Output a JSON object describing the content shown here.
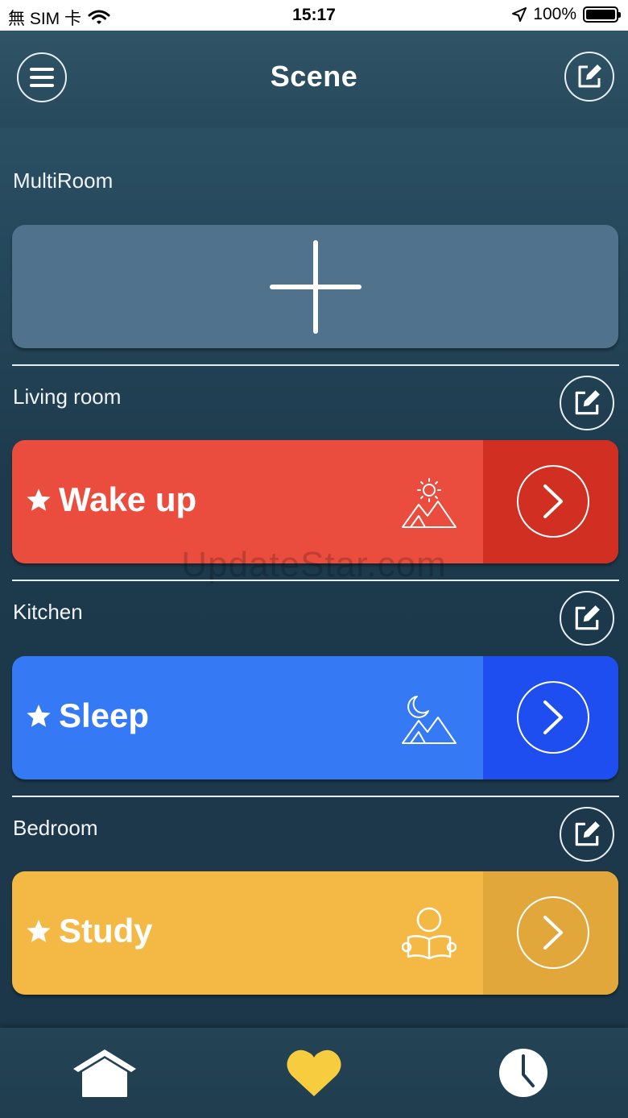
{
  "status_bar": {
    "carrier": "無 SIM 卡",
    "time": "15:17",
    "battery": "100%"
  },
  "header": {
    "title": "Scene"
  },
  "sections": {
    "multiroom": {
      "label": "MultiRoom"
    },
    "living_room": {
      "label": "Living room",
      "scene": {
        "name": "Wake up",
        "icon": "sunrise-mountain-icon"
      }
    },
    "kitchen": {
      "label": "Kitchen",
      "scene": {
        "name": "Sleep",
        "icon": "moon-mountain-icon"
      }
    },
    "bedroom": {
      "label": "Bedroom",
      "scene": {
        "name": "Study",
        "icon": "reading-person-icon"
      }
    }
  },
  "watermark": "UpdateStar.com",
  "tabs": [
    {
      "name": "home-icon"
    },
    {
      "name": "heart-icon",
      "active": true
    },
    {
      "name": "clock-icon"
    }
  ],
  "colors": {
    "wake_up": "#ea4c3d",
    "wake_up_side": "#d22f23",
    "sleep": "#3679f5",
    "sleep_side": "#1e4ef0",
    "study": "#f3b944",
    "study_side": "#e1a73a",
    "heart_active": "#f7cd3f"
  }
}
